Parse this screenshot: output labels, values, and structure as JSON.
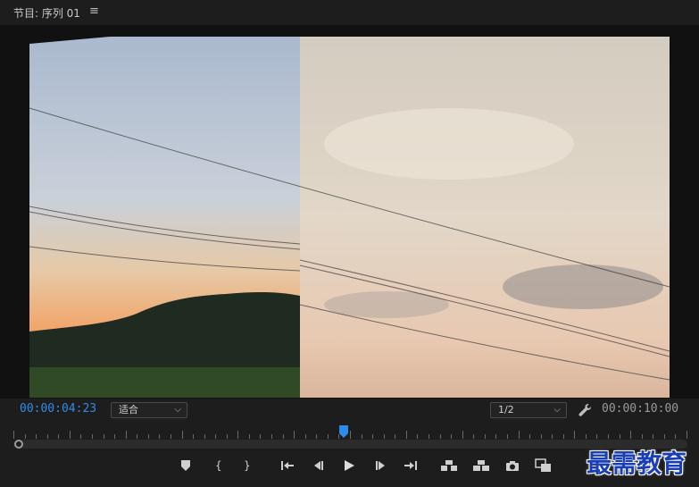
{
  "panel": {
    "title": "节目: 序列 01",
    "menu_icon": "hamburger-menu-icon"
  },
  "viewer": {
    "current_timecode": "00:00:04:23",
    "fit_select": {
      "selected": "适合"
    },
    "resolution_select": {
      "selected": "1/2"
    },
    "settings_icon": "wrench-icon",
    "duration_timecode": "00:00:10:00",
    "playhead_position_fraction": 0.49
  },
  "transport": {
    "buttons": [
      {
        "name": "add-marker-button",
        "icon": "marker-icon"
      },
      {
        "name": "mark-in-button",
        "icon": "mark-in-icon"
      },
      {
        "name": "mark-out-button",
        "icon": "mark-out-icon"
      },
      {
        "name": "go-to-in-button",
        "icon": "go-to-in-icon"
      },
      {
        "name": "step-back-button",
        "icon": "step-back-icon"
      },
      {
        "name": "play-button",
        "icon": "play-icon"
      },
      {
        "name": "step-forward-button",
        "icon": "step-forward-icon"
      },
      {
        "name": "go-to-out-button",
        "icon": "go-to-out-icon"
      },
      {
        "name": "lift-button",
        "icon": "lift-icon"
      },
      {
        "name": "extract-button",
        "icon": "extract-icon"
      },
      {
        "name": "export-frame-button",
        "icon": "camera-icon"
      },
      {
        "name": "comparison-view-button",
        "icon": "comparison-icon"
      }
    ]
  },
  "watermark": {
    "text": "最需教育"
  },
  "colors": {
    "accent": "#2d8ceb",
    "background": "#1d1d1d",
    "watermark": "#1a3fb5"
  }
}
